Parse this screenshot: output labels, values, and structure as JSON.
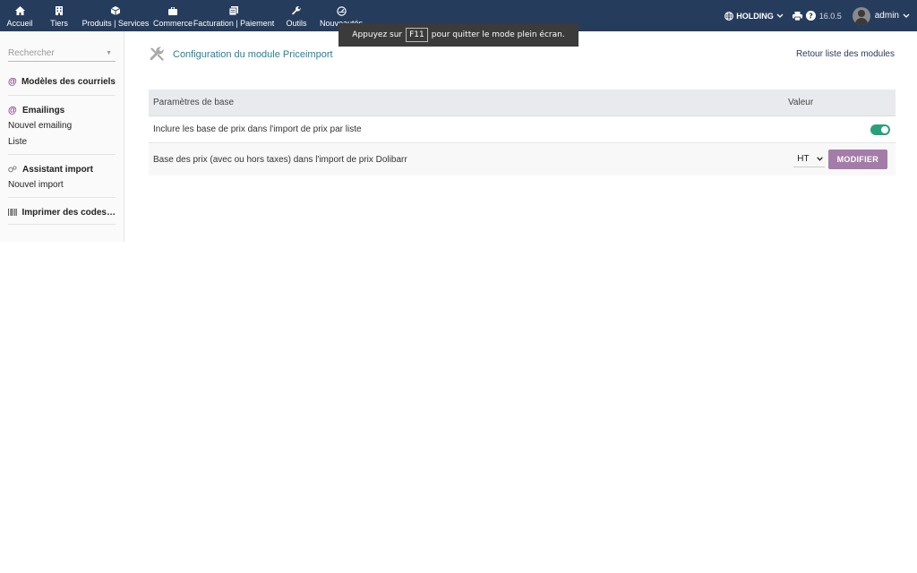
{
  "topnav": [
    {
      "label": "Accueil",
      "icon": "home-icon"
    },
    {
      "label": "Tiers",
      "icon": "building-icon"
    },
    {
      "label": "Produits | Services",
      "icon": "cube-icon"
    },
    {
      "label": "Commerce",
      "icon": "briefcase-icon"
    },
    {
      "label": "Facturation | Paiement",
      "icon": "invoice-icon"
    },
    {
      "label": "Outils",
      "icon": "wrench-icon"
    },
    {
      "label": "Nouveautés",
      "icon": "gauge-icon"
    }
  ],
  "header": {
    "company": "HOLDING",
    "version": "16.0.5",
    "user": "admin"
  },
  "toast": {
    "prefix": "Appuyez sur",
    "key": "F11",
    "suffix": "pour quitter le mode plein écran."
  },
  "sidebar": {
    "search_placeholder": "Rechercher",
    "blocks": [
      {
        "title": "Modèles des courriels",
        "icon": "at-icon",
        "items": []
      },
      {
        "title": "Emailings",
        "icon": "at-icon",
        "items": [
          "Nouvel emailing",
          "Liste"
        ]
      },
      {
        "title": "Assistant import",
        "icon": "cogs-icon",
        "items": [
          "Nouvel import"
        ]
      },
      {
        "title": "Imprimer des codes…",
        "icon": "barcode-icon",
        "items": []
      }
    ]
  },
  "main": {
    "title": "Configuration du module Priceimport",
    "back_link": "Retour liste des modules",
    "table": {
      "col_param": "Paramètres de base",
      "col_value": "Valeur",
      "rows": [
        {
          "label": "Inclure les base de prix dans l'import de prix par liste",
          "toggle_on": true
        },
        {
          "label": "Base des prix (avec ou hors taxes) dans l'import de prix Dolibarr",
          "select_value": "HT",
          "button": "MODIFIER"
        }
      ]
    }
  },
  "colors": {
    "topbar": "#263c5c",
    "accent": "#a47ca8",
    "toggle_on": "#29a07b",
    "title_link": "#25819c"
  }
}
